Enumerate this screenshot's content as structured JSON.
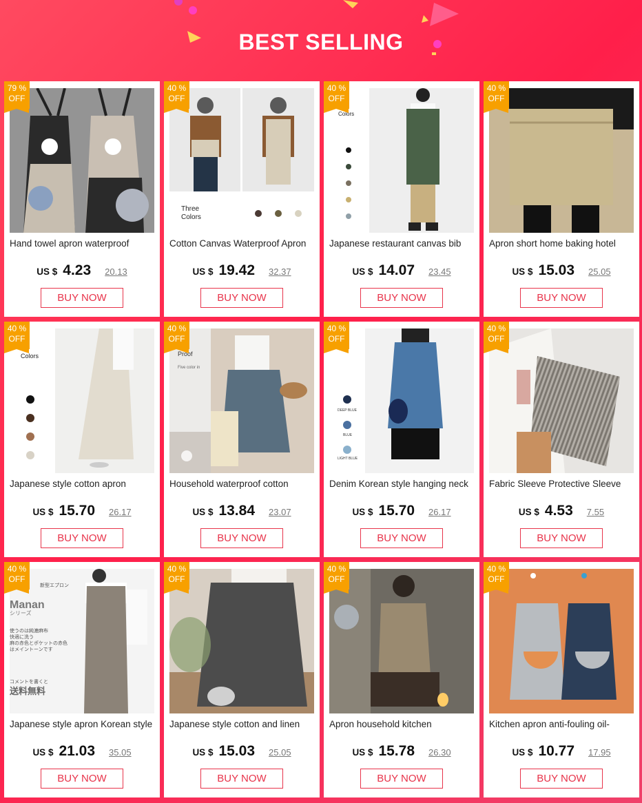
{
  "header": {
    "title": "BEST SELLING"
  },
  "buy_label": "BUY NOW",
  "currency": "US $",
  "colors": {
    "accent": "#ff1f4a",
    "badge": "#f7a000",
    "button": "#e8334a"
  },
  "products": [
    {
      "badge_pct": "79 %",
      "badge_off": "OFF",
      "name": "Hand towel apron waterproof",
      "price": "4.23",
      "orig": "20.13",
      "photo_text": []
    },
    {
      "badge_pct": "40 %",
      "badge_off": "OFF",
      "name": "Cotton Canvas Waterproof Apron",
      "price": "19.42",
      "orig": "32.37",
      "photo_text": [
        "Three",
        "Colors"
      ]
    },
    {
      "badge_pct": "40 %",
      "badge_off": "OFF",
      "name": "Japanese restaurant canvas bib",
      "price": "14.07",
      "orig": "23.45",
      "photo_text": [
        "Colors"
      ]
    },
    {
      "badge_pct": "40 %",
      "badge_off": "OFF",
      "name": "Apron short home baking hotel",
      "price": "15.03",
      "orig": "25.05",
      "photo_text": []
    },
    {
      "badge_pct": "40 %",
      "badge_off": "OFF",
      "name": "Japanese style cotton apron",
      "price": "15.70",
      "orig": "26.17",
      "photo_text": [
        "Colors"
      ]
    },
    {
      "badge_pct": "40 %",
      "badge_off": "OFF",
      "name": "Household waterproof cotton",
      "price": "13.84",
      "orig": "23.07",
      "photo_text": [
        "Proof",
        "Five color in"
      ]
    },
    {
      "badge_pct": "40 %",
      "badge_off": "OFF",
      "name": "Denim Korean style hanging neck",
      "price": "15.70",
      "orig": "26.17",
      "photo_text": [
        "DEEP BLUE",
        "BLUE",
        "LIGHT BLUE"
      ]
    },
    {
      "badge_pct": "40 %",
      "badge_off": "OFF",
      "name": "Fabric Sleeve Protective Sleeve",
      "price": "4.53",
      "orig": "7.55",
      "photo_text": []
    },
    {
      "badge_pct": "40 %",
      "badge_off": "OFF",
      "name": "Japanese style apron Korean style",
      "price": "21.03",
      "orig": "35.05",
      "photo_text": [
        "Manan",
        "シリーズ",
        "新型エプロン",
        "使うのは純漉麻布",
        "快適に洗う",
        "麻の赤色とポケットの赤色",
        "はメイントーンです",
        "コメントを書くと",
        "送料無料"
      ]
    },
    {
      "badge_pct": "40 %",
      "badge_off": "OFF",
      "name": "Japanese style cotton and linen",
      "price": "15.03",
      "orig": "25.05",
      "photo_text": []
    },
    {
      "badge_pct": "40 %",
      "badge_off": "OFF",
      "name": "Apron household kitchen",
      "price": "15.78",
      "orig": "26.30",
      "photo_text": []
    },
    {
      "badge_pct": "40 %",
      "badge_off": "OFF",
      "name": "Kitchen apron anti-fouling oil-",
      "price": "10.77",
      "orig": "17.95",
      "photo_text": []
    }
  ]
}
